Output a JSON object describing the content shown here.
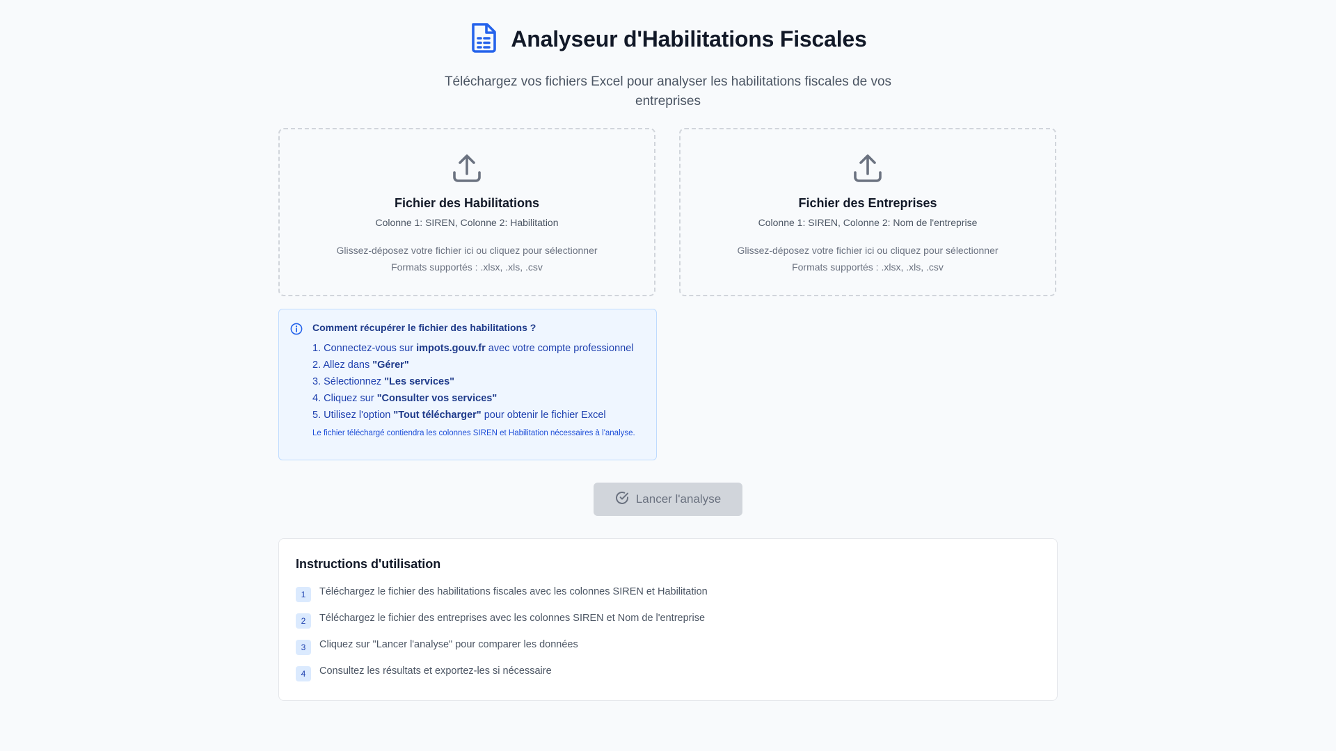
{
  "header": {
    "title": "Analyseur d'Habilitations Fiscales",
    "subtitle": "Téléchargez vos fichiers Excel pour analyser les habilitations fiscales de vos entreprises",
    "icon": "file-spreadsheet-icon"
  },
  "uploads": [
    {
      "title": "Fichier des Habilitations",
      "columns": "Colonne 1: SIREN, Colonne 2: Habilitation",
      "hint": "Glissez-déposez votre fichier ici ou cliquez pour sélectionner",
      "formats": "Formats supportés : .xlsx, .xls, .csv",
      "icon": "upload-icon"
    },
    {
      "title": "Fichier des Entreprises",
      "columns": "Colonne 1: SIREN, Colonne 2: Nom de l'entreprise",
      "hint": "Glissez-déposez votre fichier ici ou cliquez pour sélectionner",
      "formats": "Formats supportés : .xlsx, .xls, .csv",
      "icon": "upload-icon"
    }
  ],
  "info": {
    "title": "Comment récupérer le fichier des habilitations ?",
    "steps": [
      {
        "pre": "1. Connectez-vous sur ",
        "bold": "impots.gouv.fr",
        "post": " avec votre compte professionnel"
      },
      {
        "pre": "2. Allez dans ",
        "bold": "\"Gérer\"",
        "post": ""
      },
      {
        "pre": "3. Sélectionnez ",
        "bold": "\"Les services\"",
        "post": ""
      },
      {
        "pre": "4. Cliquez sur ",
        "bold": "\"Consulter vos services\"",
        "post": ""
      },
      {
        "pre": "5. Utilisez l'option ",
        "bold": "\"Tout télécharger\"",
        "post": " pour obtenir le fichier Excel"
      }
    ],
    "note": "Le fichier téléchargé contiendra les colonnes SIREN et Habilitation nécessaires à l'analyse."
  },
  "analyze_button": {
    "label": "Lancer l'analyse",
    "icon": "check-circle-icon",
    "disabled": true
  },
  "instructions": {
    "title": "Instructions d'utilisation",
    "steps": [
      {
        "num": "1",
        "text": "Téléchargez le fichier des habilitations fiscales avec les colonnes SIREN et Habilitation"
      },
      {
        "num": "2",
        "text": "Téléchargez le fichier des entreprises avec les colonnes SIREN et Nom de l'entreprise"
      },
      {
        "num": "3",
        "text": "Cliquez sur \"Lancer l'analyse\" pour comparer les données"
      },
      {
        "num": "4",
        "text": "Consultez les résultats et exportez-les si nécessaire"
      }
    ]
  },
  "colors": {
    "accent": "#2563eb",
    "background": "#f8fafc",
    "info_bg": "#eff6ff",
    "button_disabled": "#d1d5db"
  }
}
